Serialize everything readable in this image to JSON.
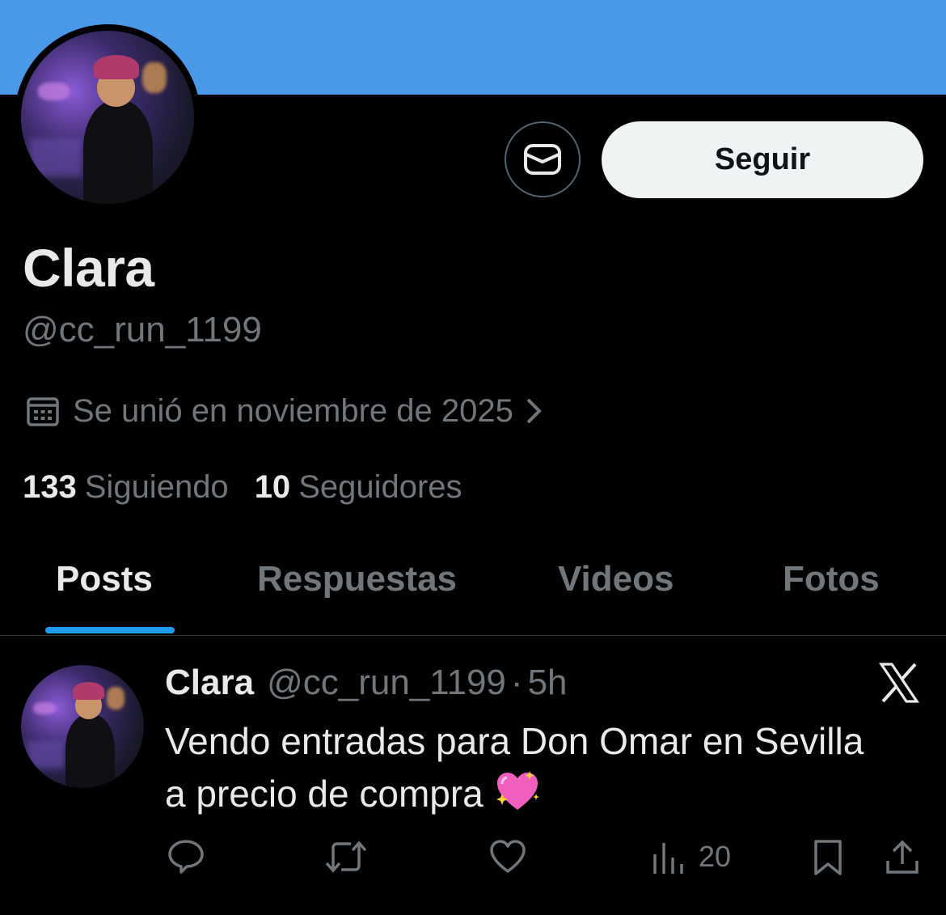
{
  "profile": {
    "name": "Clara",
    "handle": "@cc_run_1199",
    "joined": "Se unió en noviembre de 2025",
    "following_count": "133",
    "following_label": "Siguiendo",
    "followers_count": "10",
    "followers_label": "Seguidores"
  },
  "actions": {
    "follow_label": "Seguir"
  },
  "tabs": [
    {
      "label": "Posts",
      "active": true
    },
    {
      "label": "Respuestas",
      "active": false
    },
    {
      "label": "Videos",
      "active": false
    },
    {
      "label": "Fotos",
      "active": false
    }
  ],
  "post": {
    "name": "Clara",
    "handle": "@cc_run_1199",
    "separator": "·",
    "time": "5h",
    "text": "Vendo entradas para Don Omar en Sevilla a precio de compra",
    "emoji": "sparkling-heart",
    "views": "20"
  },
  "colors": {
    "banner": "#4a99e9",
    "background": "#000000",
    "accent": "#1d9bf0",
    "muted": "#71767b",
    "text": "#e7e9ea"
  },
  "icons": [
    "envelope-icon",
    "calendar-icon",
    "chevron-right-icon",
    "x-logo-icon",
    "reply-icon",
    "repost-icon",
    "like-icon",
    "views-icon",
    "bookmark-icon",
    "share-icon"
  ]
}
